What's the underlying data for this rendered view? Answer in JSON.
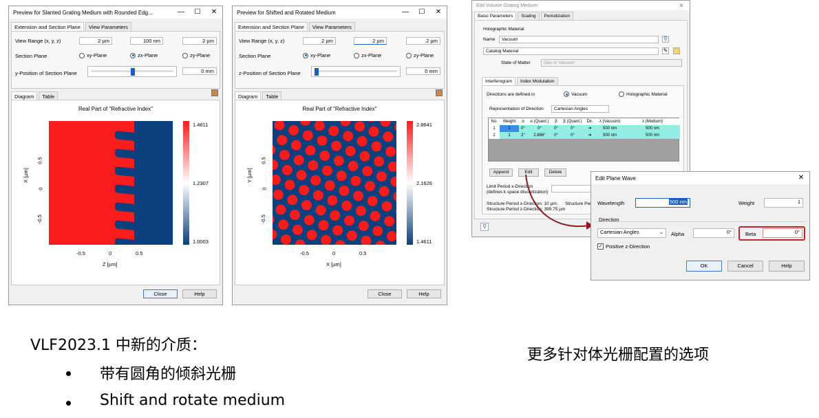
{
  "w1": {
    "title": "Preview for Slanted Grating Medium with Rounded Edg...",
    "tab1": "Extension and Section Plane",
    "tab2": "View Parameters",
    "view_range_label": "View Range (x, y, z)",
    "vr_x": "2 µm",
    "vr_y": "100 nm",
    "vr_z": "2 µm",
    "section_plane_label": "Section Plane",
    "opt_xy": "xy-Plane",
    "opt_zx": "zx-Plane",
    "opt_zy": "zy-Plane",
    "selected": "zx-Plane",
    "pos_label": "y-Position of Section Plane",
    "pos_value": "0 mm",
    "dtab1": "Diagram",
    "dtab2": "Table",
    "plot_title": "Real Part of \"Refractive Index\"",
    "ylabel": "X [µm]",
    "xlabel": "Z [µm]",
    "xticks": [
      "-0.5",
      "0",
      "0.5"
    ],
    "yticks": [
      "0.5",
      "0",
      "-0.5"
    ],
    "cbar_max": "1.4611",
    "cbar_mid": "1.2307",
    "cbar_min": "1.0003",
    "close": "Close",
    "help": "Help"
  },
  "w2": {
    "title": "Preview for Shifted and Rotated Medium",
    "tab1": "Extension and Section Plane",
    "tab2": "View Parameters",
    "view_range_label": "View Range (x, y, z)",
    "vr_x": "2 µm",
    "vr_y": "2 µm",
    "vr_z": "2 µm",
    "section_plane_label": "Section Plane",
    "opt_xy": "xy-Plane",
    "opt_zx": "zx-Plane",
    "opt_zy": "zy-Plane",
    "selected": "xy-Plane",
    "pos_label": "z-Position of Section Plane",
    "pos_value": "0 mm",
    "dtab1": "Diagram",
    "dtab2": "Table",
    "plot_title": "Real Part of \"Refractive Index\"",
    "ylabel": "Y [µm]",
    "xlabel": "X [µm]",
    "xticks": [
      "-0.5",
      "0",
      "0.5"
    ],
    "yticks": [
      "0.5",
      "0",
      "-0.5"
    ],
    "cbar_max": "2.8641",
    "cbar_mid": "2.1626",
    "cbar_min": "1.4611",
    "close": "Close",
    "help": "Help"
  },
  "w3": {
    "title": "Edit Volume Grating Medium",
    "tab1": "Basic Parameters",
    "tab2": "Scaling",
    "tab3": "Periodization",
    "section": "Holographic Material",
    "name_label": "Name",
    "name_value": "Vacuum",
    "catalog": "Catalog Material",
    "state_label": "State of Matter",
    "state_value": "Gas or Vacuum",
    "itab1": "Interferogram",
    "itab2": "Index Modulation",
    "dir_label": "Directions are defined in",
    "dir_opt1": "Vacuum",
    "dir_opt2": "Holographic Material",
    "rep_label": "Representation of Direction",
    "rep_value": "Cartesian Angles",
    "headers": [
      "No.",
      "Weight",
      "α",
      "α (Quant.)",
      "β",
      "β (Quant.)",
      "Dir.",
      "λ (Vacuum)",
      "λ (Medium)"
    ],
    "rows": [
      [
        "1",
        "1",
        "0°",
        "0°",
        "0°",
        "0°",
        "➔",
        "500 nm",
        "500 nm"
      ],
      [
        "2",
        "1",
        "2°",
        "2.866°",
        "0°",
        "0°",
        "➔",
        "500 nm",
        "500 nm"
      ]
    ],
    "append": "Append",
    "edit": "Edit",
    "delete": "Delete",
    "limit_label": "Limit Period x-Direction",
    "limit_sub": "(defines k space discretization)",
    "limit_value": "10",
    "struct1": "Structure Period x-Direction: 10 µm;",
    "struct1b": "Structure Peri",
    "struct2": "Structure Period z-Direction: 399.75 µm"
  },
  "w4": {
    "title": "Edit Plane Wave",
    "wl_label": "Wavelength",
    "wl_value": "500 nm",
    "weight_label": "Weight",
    "weight_value": "1",
    "direction_label": "Direction",
    "dir_type": "Cartesian Angles",
    "alpha_label": "Alpha",
    "alpha_value": "0°",
    "beta_label": "Beta",
    "beta_value": "0°",
    "positive_z": "Positive z-Direction",
    "ok": "OK",
    "cancel": "Cancel",
    "help": "Help"
  },
  "caption": {
    "heading": "VLF2023.1 中新的介质：",
    "item1": "带有圆角的倾斜光栅",
    "item2": "Shift and rotate medium",
    "right": "更多针对体光栅配置的选项"
  },
  "colors": {
    "red": "#f81c1c",
    "blue": "#0b3f7d",
    "teal": "#94ede2",
    "highlight": "#c0232b",
    "accent": "#1a5fc0"
  }
}
